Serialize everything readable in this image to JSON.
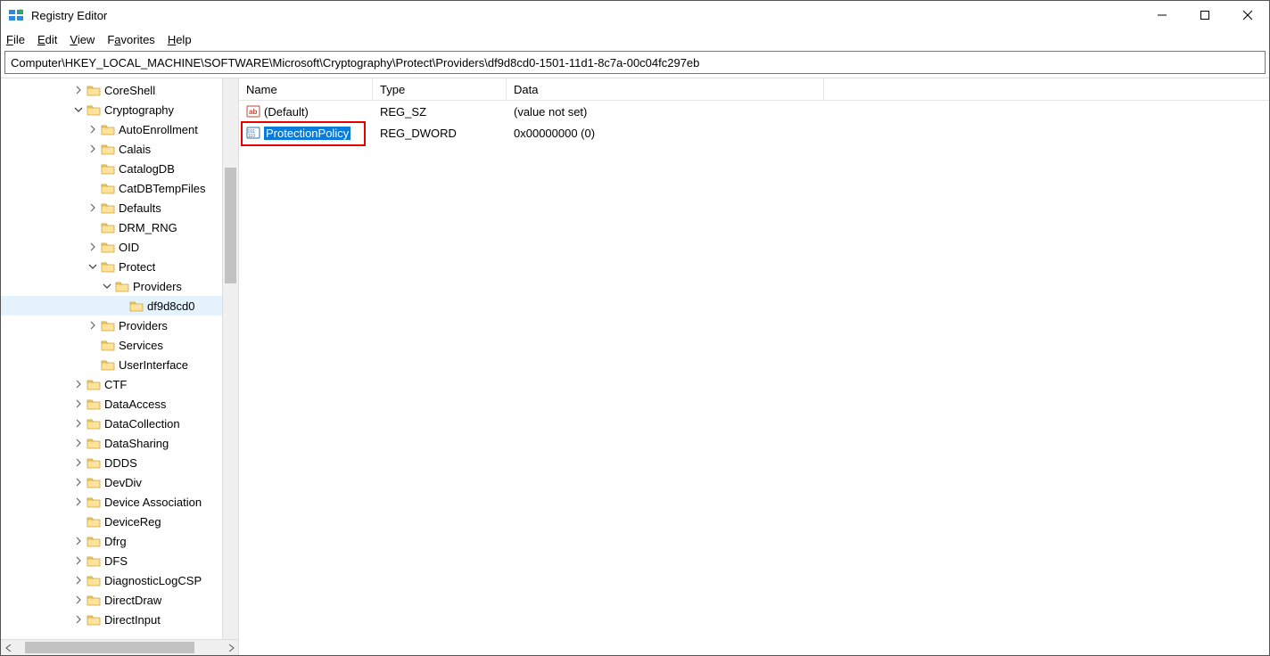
{
  "window": {
    "title": "Registry Editor"
  },
  "menu": {
    "file": "File",
    "edit": "Edit",
    "view": "View",
    "favorites": "Favorites",
    "help": "Help"
  },
  "address": "Computer\\HKEY_LOCAL_MACHINE\\SOFTWARE\\Microsoft\\Cryptography\\Protect\\Providers\\df9d8cd0-1501-11d1-8c7a-00c04fc297eb",
  "tree": [
    {
      "indent": 5,
      "chevron": "right",
      "label": "CoreShell"
    },
    {
      "indent": 5,
      "chevron": "down",
      "label": "Cryptography"
    },
    {
      "indent": 6,
      "chevron": "right",
      "label": "AutoEnrollment"
    },
    {
      "indent": 6,
      "chevron": "right",
      "label": "Calais"
    },
    {
      "indent": 6,
      "chevron": "blank",
      "label": "CatalogDB"
    },
    {
      "indent": 6,
      "chevron": "blank",
      "label": "CatDBTempFiles"
    },
    {
      "indent": 6,
      "chevron": "right",
      "label": "Defaults"
    },
    {
      "indent": 6,
      "chevron": "blank",
      "label": "DRM_RNG"
    },
    {
      "indent": 6,
      "chevron": "right",
      "label": "OID"
    },
    {
      "indent": 6,
      "chevron": "down",
      "label": "Protect"
    },
    {
      "indent": 7,
      "chevron": "down",
      "label": "Providers"
    },
    {
      "indent": 8,
      "chevron": "blank",
      "label": "df9d8cd0",
      "selected": true
    },
    {
      "indent": 6,
      "chevron": "right",
      "label": "Providers"
    },
    {
      "indent": 6,
      "chevron": "blank",
      "label": "Services"
    },
    {
      "indent": 6,
      "chevron": "blank",
      "label": "UserInterface"
    },
    {
      "indent": 5,
      "chevron": "right",
      "label": "CTF"
    },
    {
      "indent": 5,
      "chevron": "right",
      "label": "DataAccess"
    },
    {
      "indent": 5,
      "chevron": "right",
      "label": "DataCollection"
    },
    {
      "indent": 5,
      "chevron": "right",
      "label": "DataSharing"
    },
    {
      "indent": 5,
      "chevron": "right",
      "label": "DDDS"
    },
    {
      "indent": 5,
      "chevron": "right",
      "label": "DevDiv"
    },
    {
      "indent": 5,
      "chevron": "right",
      "label": "Device Association"
    },
    {
      "indent": 5,
      "chevron": "blank",
      "label": "DeviceReg"
    },
    {
      "indent": 5,
      "chevron": "right",
      "label": "Dfrg"
    },
    {
      "indent": 5,
      "chevron": "right",
      "label": "DFS"
    },
    {
      "indent": 5,
      "chevron": "right",
      "label": "DiagnosticLogCSP"
    },
    {
      "indent": 5,
      "chevron": "right",
      "label": "DirectDraw"
    },
    {
      "indent": 5,
      "chevron": "right",
      "label": "DirectInput"
    }
  ],
  "columns": {
    "name": "Name",
    "type": "Type",
    "data": "Data"
  },
  "values": [
    {
      "icon": "sz",
      "name": "(Default)",
      "type": "REG_SZ",
      "data": "(value not set)",
      "selected": false
    },
    {
      "icon": "dword",
      "name": "ProtectionPolicy",
      "type": "REG_DWORD",
      "data": "0x00000000 (0)",
      "selected": true
    }
  ]
}
